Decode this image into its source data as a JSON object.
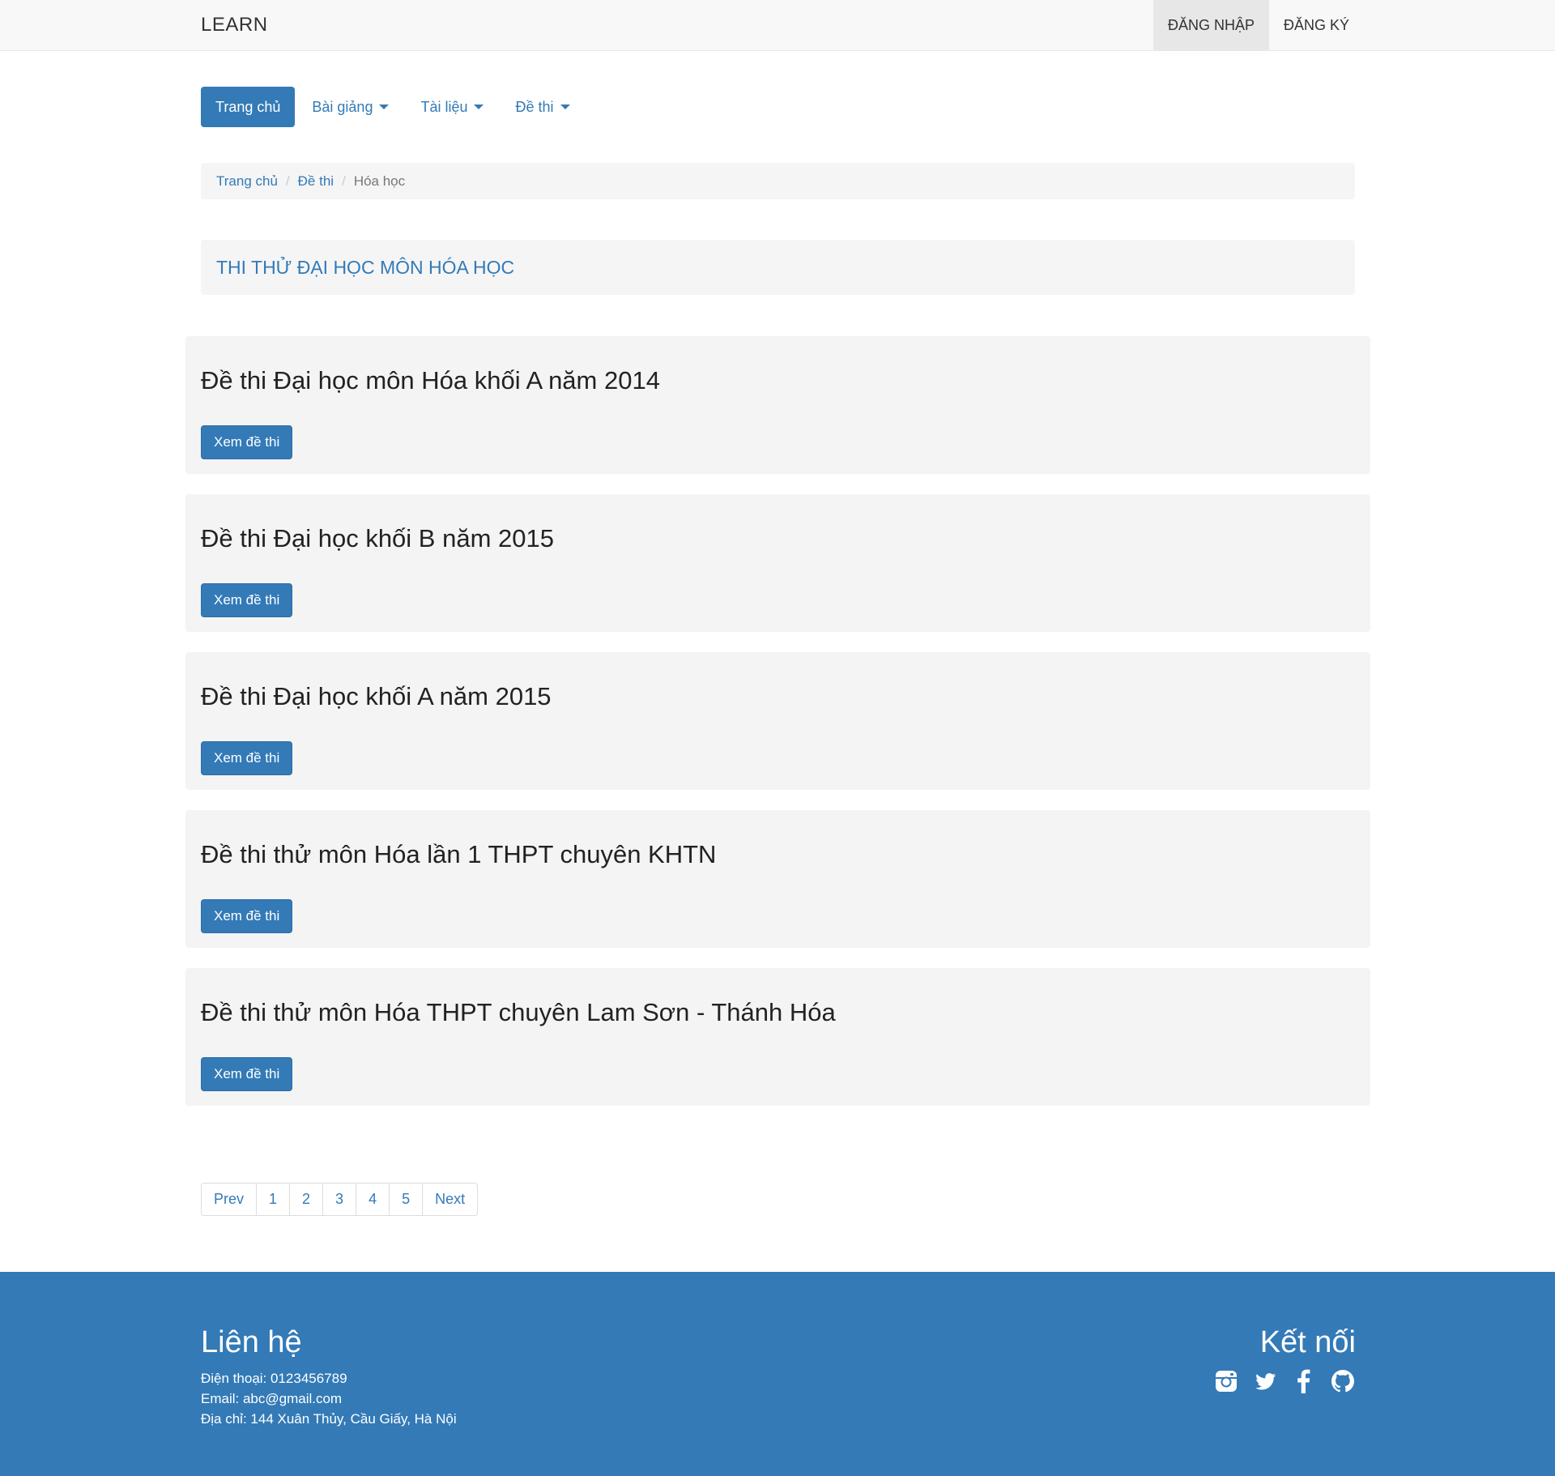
{
  "navbar": {
    "brand": "LEARN",
    "login": "ĐĂNG NHẬP",
    "register": "ĐĂNG KÝ"
  },
  "menu": {
    "home": "Trang chủ",
    "lectures": "Bài giảng",
    "documents": "Tài liệu",
    "exams": "Đề thi"
  },
  "breadcrumb": [
    "Trang chủ",
    "Đề thi",
    "Hóa học"
  ],
  "section_title": "THI THỬ ĐẠI HỌC MÔN HÓA HỌC",
  "exams": [
    {
      "title": "Đề thi Đại học môn Hóa khối A năm 2014",
      "button": "Xem đề thi"
    },
    {
      "title": "Đề thi Đại học khối B năm 2015",
      "button": "Xem đề thi"
    },
    {
      "title": "Đề thi Đại học khối A năm 2015",
      "button": "Xem đề thi"
    },
    {
      "title": "Đề thi thử môn Hóa lần 1 THPT chuyên KHTN",
      "button": "Xem đề thi"
    },
    {
      "title": "Đề thi thử môn Hóa THPT chuyên Lam Sơn - Thánh Hóa",
      "button": "Xem đề thi"
    }
  ],
  "pagination": [
    "Prev",
    "1",
    "2",
    "3",
    "4",
    "5",
    "Next"
  ],
  "footer": {
    "contact_title": "Liên hệ",
    "phone": "Điện thoại: 0123456789",
    "email": "Email: abc@gmail.com",
    "address": "Địa chỉ: 144 Xuân Thủy, Cầu Giấy, Hà Nội",
    "connect_title": "Kết nối",
    "social_icons": [
      "instagram-icon",
      "twitter-icon",
      "facebook-icon",
      "github-icon"
    ]
  },
  "colors": {
    "primary": "#337ab7",
    "panel": "#f4f4f4",
    "navbar": "#f8f8f8"
  }
}
